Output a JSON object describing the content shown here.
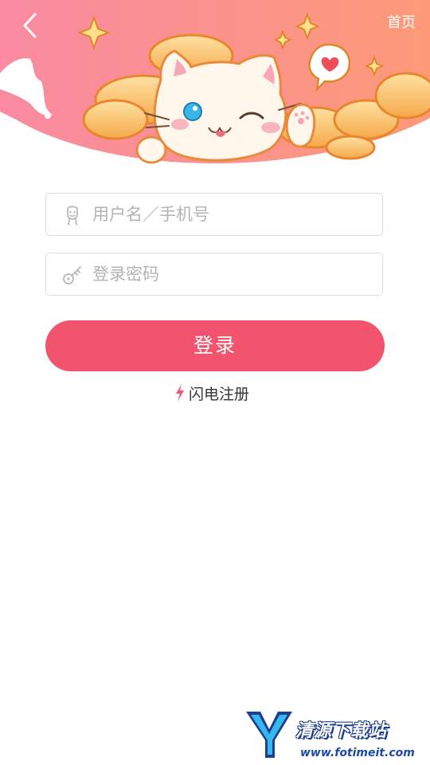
{
  "header": {
    "home_label": "首页"
  },
  "login_form": {
    "username_placeholder": "用户名／手机号",
    "password_placeholder": "登录密码",
    "login_label": "登录",
    "register_label": "闪电注册"
  },
  "watermark": {
    "title": "清源下载站",
    "url": "www.fotimeit.com"
  },
  "colors": {
    "accent": "#f1546c",
    "header_gradient_start": "#f98aa2",
    "header_gradient_end": "#fc9a78"
  }
}
